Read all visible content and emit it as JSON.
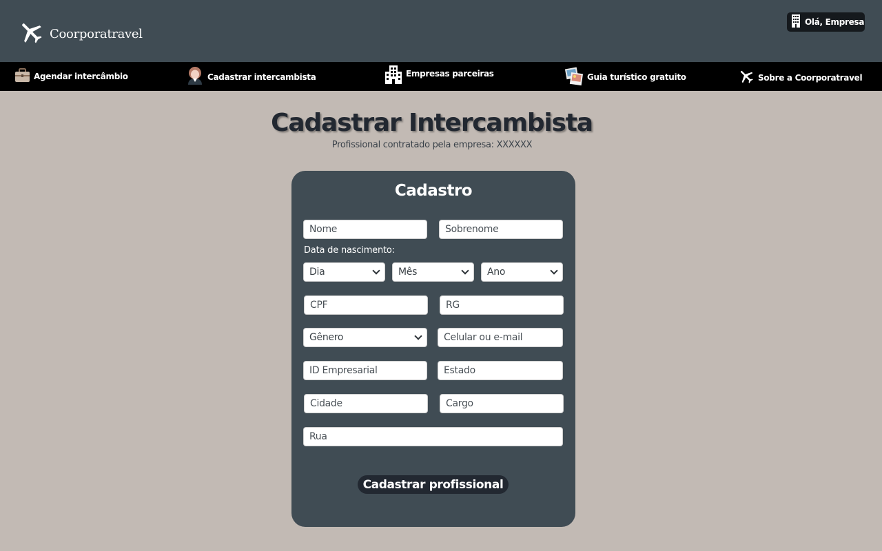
{
  "header": {
    "logo_text": "Coorporatravel",
    "greeting": "Olá, Empresa"
  },
  "nav": {
    "items": [
      {
        "label": "Agendar intercâmbio",
        "icon": "briefcase-icon"
      },
      {
        "label": "Cadastrar intercambista",
        "icon": "person-icon"
      },
      {
        "label": "Empresas parceiras",
        "icon": "building-icon"
      },
      {
        "label": "Guia turístico gratuito",
        "icon": "photos-icon"
      },
      {
        "label": "Sobre a Coorporatravel",
        "icon": "airplane-icon"
      }
    ]
  },
  "page": {
    "title": "Cadastrar Intercambista",
    "subtitle": "Profissional contratado pela empresa: XXXXXX"
  },
  "form": {
    "heading": "Cadastro",
    "nome_placeholder": "Nome",
    "sobrenome_placeholder": "Sobrenome",
    "dob_label": "Data de nascimento:",
    "dia": "Dia",
    "mes": "Mês",
    "ano": "Ano",
    "cpf_placeholder": "CPF",
    "rg_placeholder": "RG",
    "genero": "Gênero",
    "contato_placeholder": "Celular ou e-mail",
    "id_empresarial_placeholder": "ID Empresarial",
    "estado_placeholder": "Estado",
    "cidade_placeholder": "Cidade",
    "cargo_placeholder": "Cargo",
    "rua_placeholder": "Rua",
    "submit_label": "Cadastrar profissional"
  },
  "colors": {
    "header_bg": "#404c54",
    "nav_bg": "#000000",
    "page_bg": "#c2bab4",
    "card_bg": "#404c54",
    "button_bg": "#222831"
  }
}
